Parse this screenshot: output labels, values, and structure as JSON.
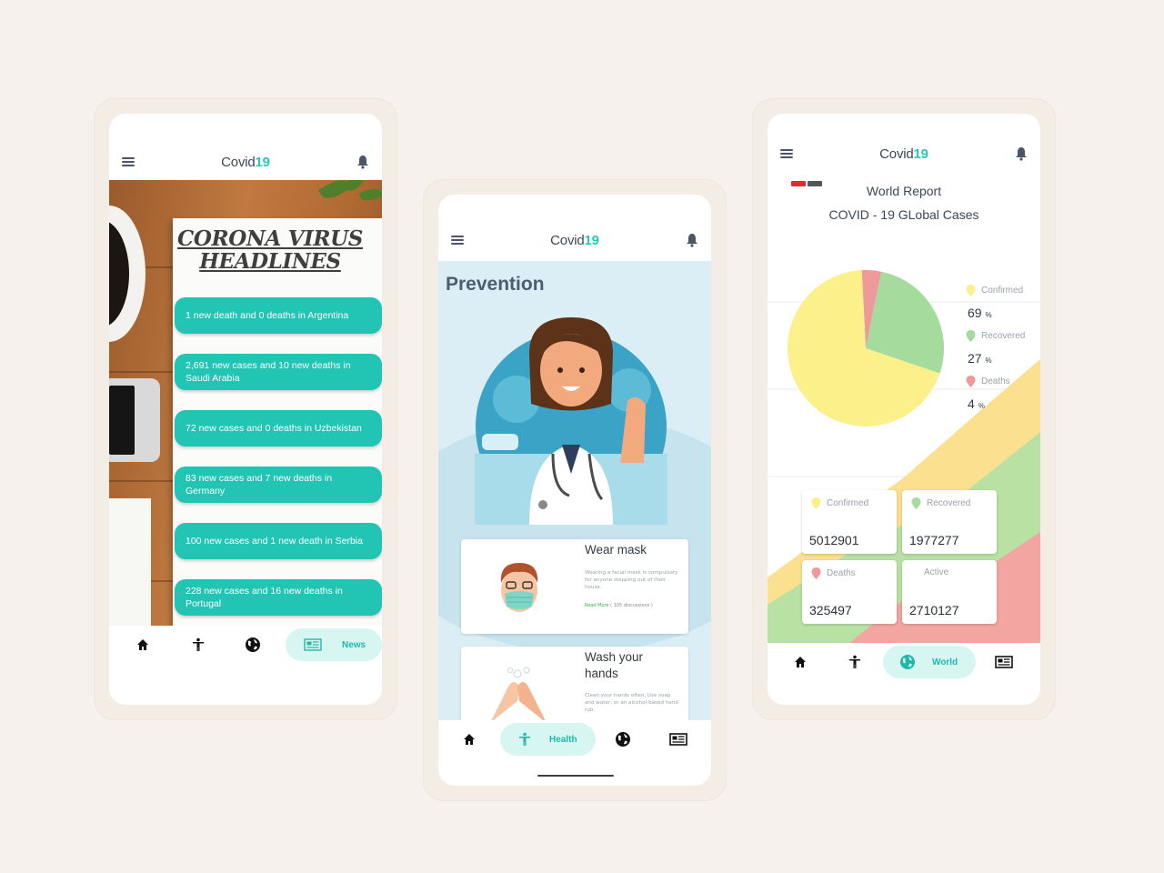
{
  "app": {
    "brand_text": "Covid",
    "brand_num": "19"
  },
  "news_screen": {
    "headline_line1": "CORONA VIRUS",
    "headline_line2": "HEADLINES",
    "items": [
      "1 new death and 0 deaths in Argentina",
      "2,691 new cases and  10 new deaths in Saudi Arabia",
      "72 new cases and 0 deaths in Uzbekistan",
      "83 new cases and  7 new deaths in Germany",
      "100 new cases and  1 new death in Serbia",
      "228 new cases and  16 new deaths in Portugal"
    ],
    "nav_active_label": "News"
  },
  "prevention_screen": {
    "title": "Prevention",
    "tips": [
      {
        "title": "Wear mask",
        "desc": "Wearing a facial mask is compulsory for anyone stepping out of their house.",
        "link_label": "Read More",
        "link_meta": "( 105 discussions )"
      },
      {
        "title": "Wash your hands",
        "desc": "Clean your hands often. Use soap and water, or an alcohol-based hand rub."
      }
    ],
    "nav_active_label": "Health"
  },
  "world_screen": {
    "title": "World Report",
    "subtitle": "COVID - 19 GLobal Cases",
    "legend": [
      {
        "label": "Confirmed",
        "pct": "69",
        "color": "#fbf08a"
      },
      {
        "label": "Recovered",
        "pct": "27",
        "color": "#a6db9e"
      },
      {
        "label": "Deaths",
        "pct": "4",
        "color": "#ee9a9a"
      }
    ],
    "pct_unit": "%",
    "stats": {
      "confirmed": {
        "label": "Confirmed",
        "value": "5012901"
      },
      "recovered": {
        "label": "Recovered",
        "value": "1977277"
      },
      "deaths": {
        "label": "Deaths",
        "value": "325497"
      },
      "active": {
        "label": "Active",
        "value": "2710127"
      }
    },
    "nav_active_label": "World"
  },
  "chart_data": {
    "type": "pie",
    "categories": [
      "Confirmed",
      "Recovered",
      "Deaths"
    ],
    "values": [
      69,
      27,
      4
    ],
    "colors": [
      "#fbf08a",
      "#a6db9e",
      "#ee9a9a"
    ],
    "legend_position": "right"
  },
  "colors": {
    "teal": "#22c5b4",
    "pill": "#d7f6f2",
    "background": "#f6f1ec"
  },
  "icons": [
    "menu-icon",
    "bell-icon",
    "home-icon",
    "person-icon",
    "globe-icon",
    "newspaper-icon"
  ]
}
